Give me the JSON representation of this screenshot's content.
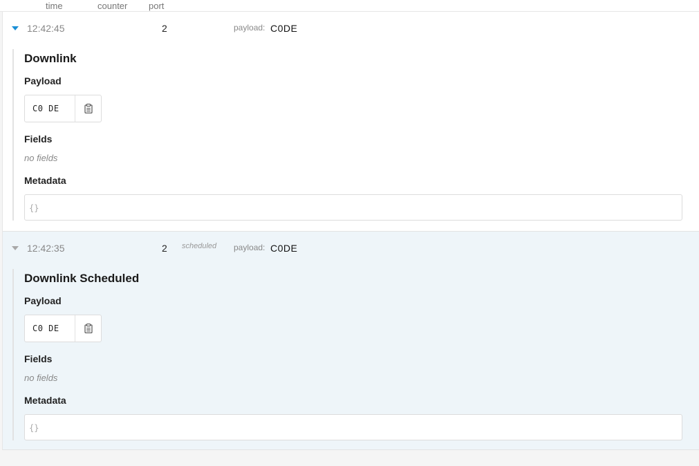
{
  "columns": {
    "time": "time",
    "counter": "counter",
    "port": "port"
  },
  "events": [
    {
      "time": "12:42:45",
      "counter": "2",
      "tag": "",
      "payload_label": "payload:",
      "payload_value": "C0DE",
      "title": "Downlink",
      "payload_heading": "Payload",
      "payload_hex": "C0 DE",
      "copy_icon": "clipboard-icon",
      "fields_heading": "Fields",
      "fields_empty": "no fields",
      "metadata_heading": "Metadata",
      "metadata_value": "{}",
      "expanded": true
    },
    {
      "time": "12:42:35",
      "counter": "2",
      "tag": "scheduled",
      "payload_label": "payload:",
      "payload_value": "C0DE",
      "title": "Downlink Scheduled",
      "payload_heading": "Payload",
      "payload_hex": "C0 DE",
      "copy_icon": "clipboard-icon",
      "fields_heading": "Fields",
      "fields_empty": "no fields",
      "metadata_heading": "Metadata",
      "metadata_value": "{}",
      "expanded": true
    }
  ],
  "colors": {
    "caret_active": "#1a8fd6",
    "caret_muted": "#a8a8a8",
    "selected_row_bg": "#eef5f9"
  }
}
